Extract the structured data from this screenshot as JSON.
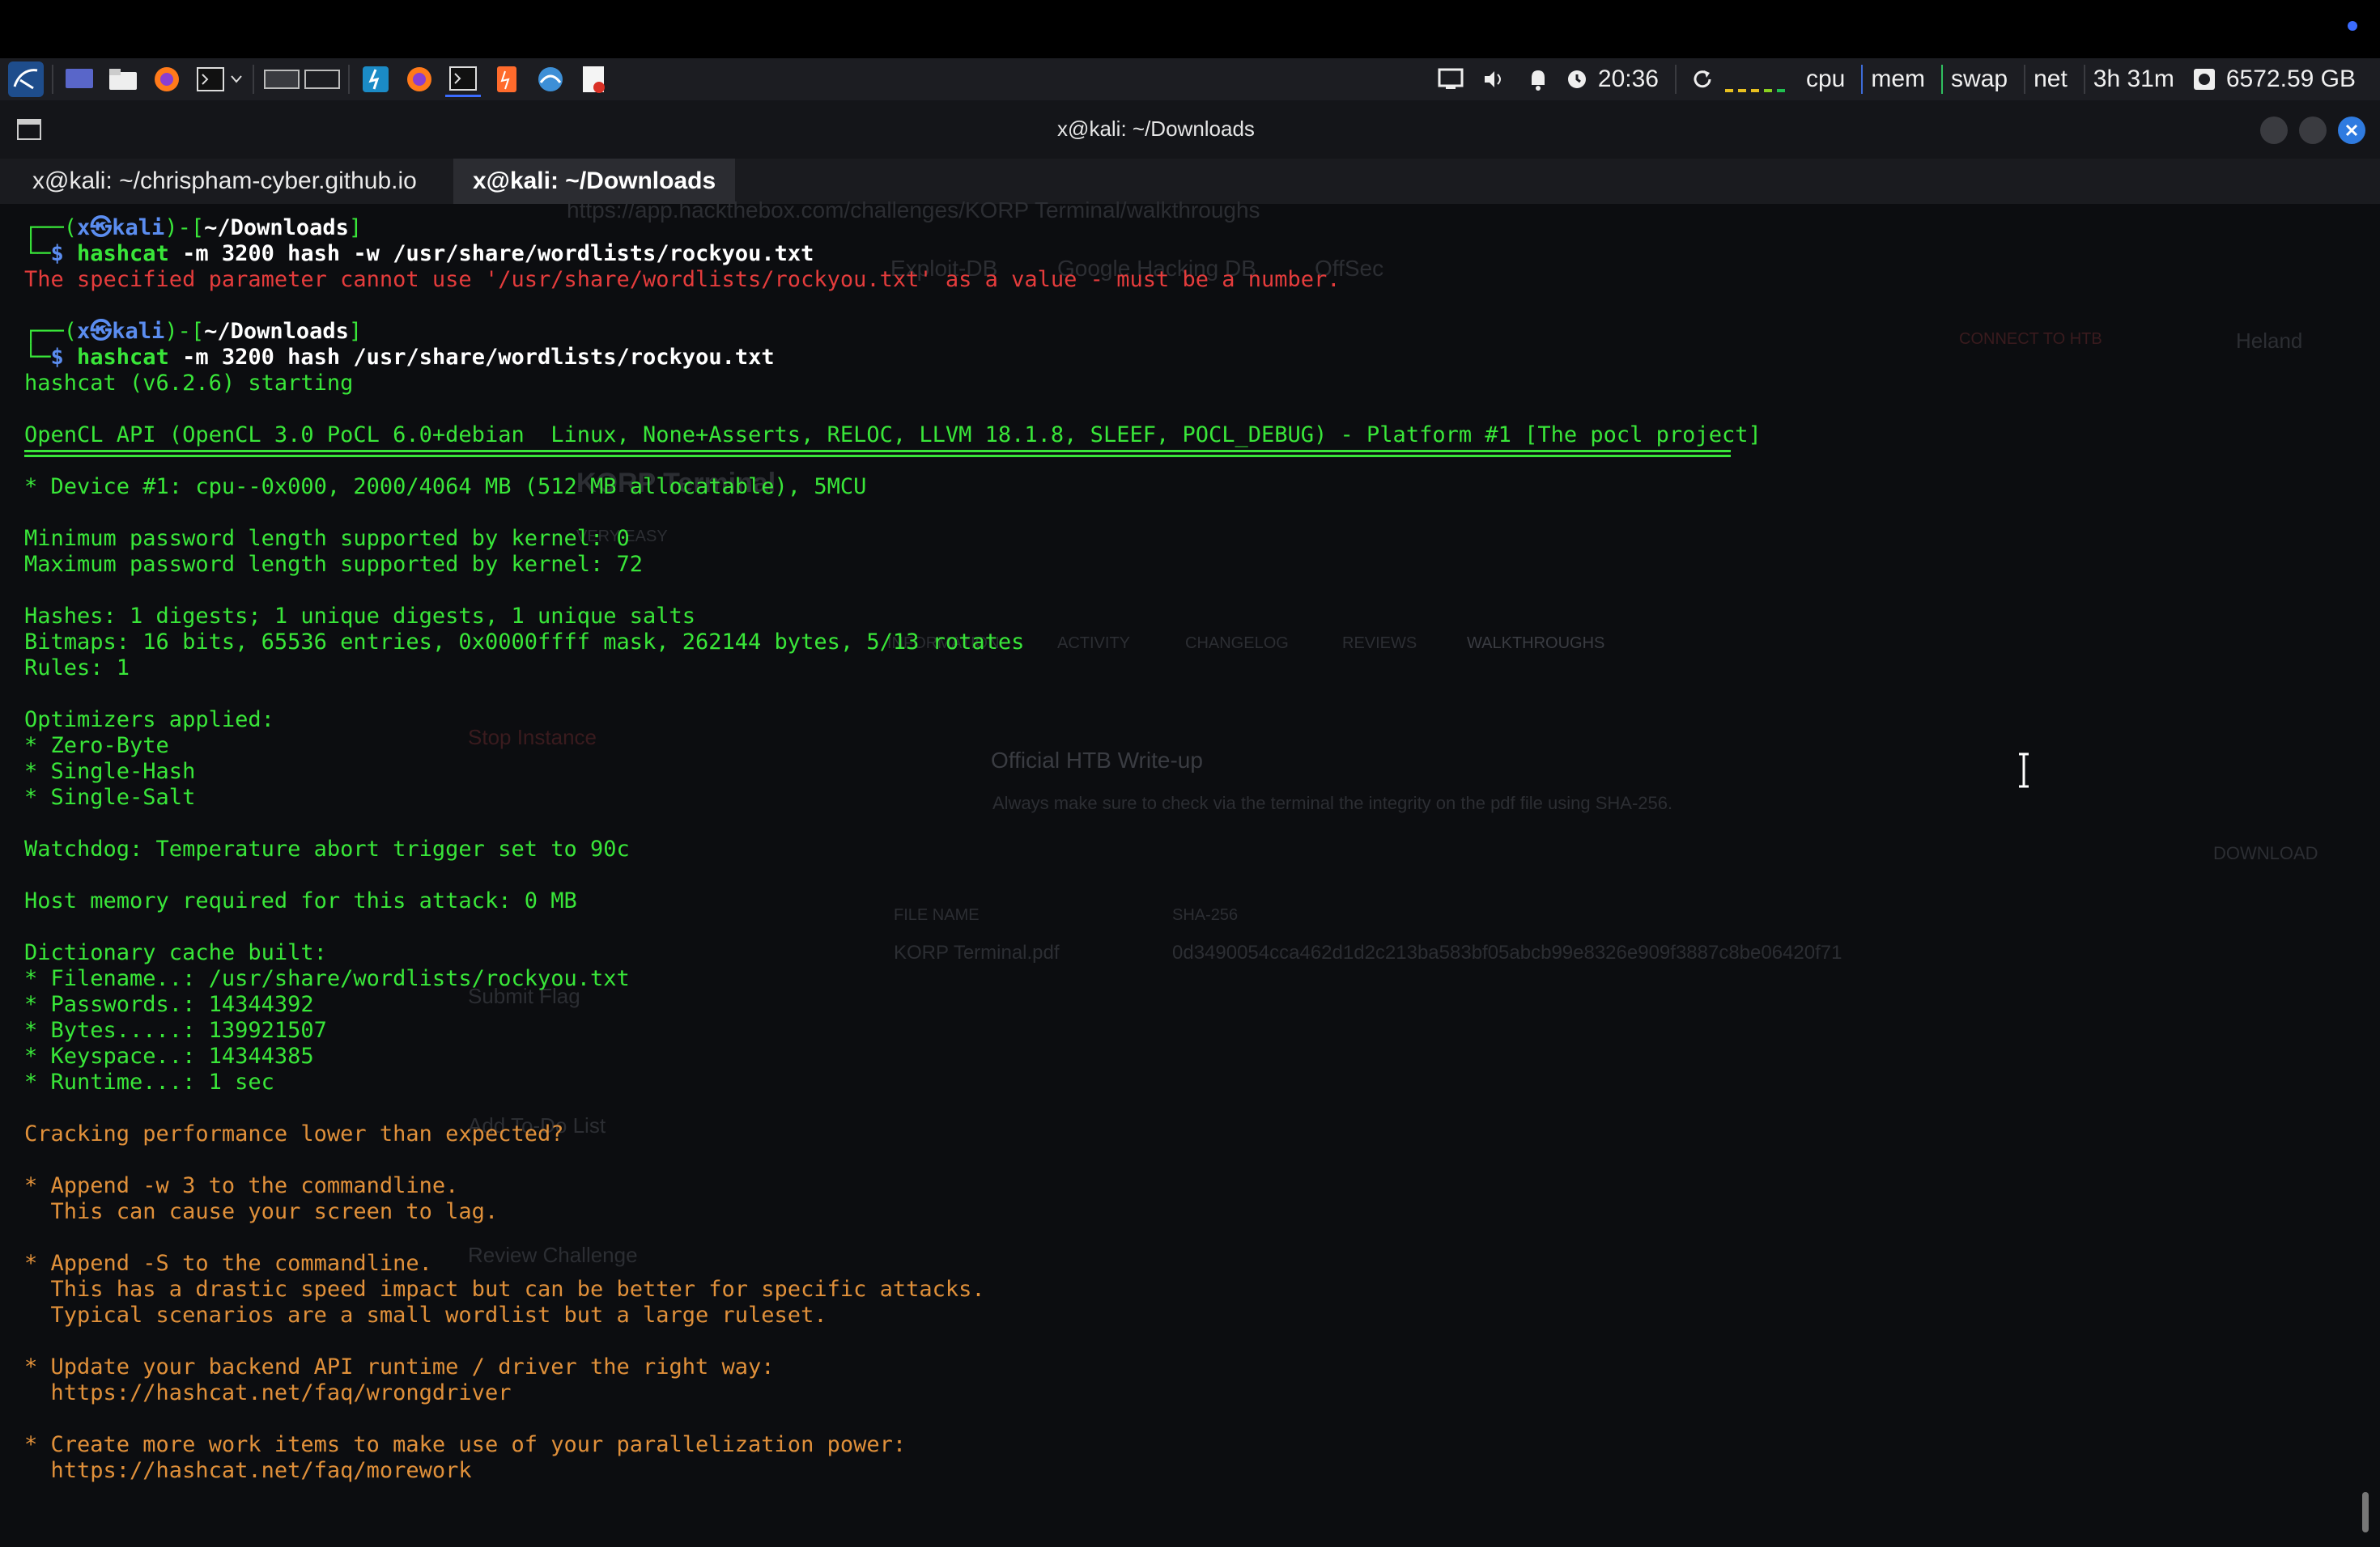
{
  "panel": {
    "clock": "20:36",
    "cpu_label": "cpu",
    "mem_label": "mem",
    "swap_label": "swap",
    "net_label": "net",
    "uptime": "3h 31m",
    "disk": "6572.59 GB"
  },
  "window": {
    "title": "x@kali: ~/Downloads",
    "tabs": [
      {
        "label": "x@kali: ~/chrispham-cyber.github.io",
        "active": false
      },
      {
        "label": "x@kali: ~/Downloads",
        "active": true
      }
    ]
  },
  "terminal": {
    "lines": [
      {
        "y": 0,
        "parts": [
          {
            "t": "┌──(",
            "c": "g"
          },
          {
            "t": "x㉿kali",
            "c": "b"
          },
          {
            "t": ")-[",
            "c": "g"
          },
          {
            "t": "~/Downloads",
            "c": "w"
          },
          {
            "t": "]",
            "c": "g"
          }
        ]
      },
      {
        "y": 1,
        "parts": [
          {
            "t": "└─",
            "c": "g"
          },
          {
            "t": "$ ",
            "c": "b"
          },
          {
            "t": "hashcat",
            "c": "gb"
          },
          {
            "t": " -m 3200 ",
            "c": "w"
          },
          {
            "t": "hash",
            "c": "w"
          },
          {
            "t": " -w ",
            "c": "w"
          },
          {
            "t": "/usr/share/wordlists/rockyou.txt",
            "c": "w"
          }
        ]
      },
      {
        "y": 2,
        "parts": [
          {
            "t": "The specified parameter cannot use '/usr/share/wordlists/rockyou.txt' as a value - must be a number.",
            "c": "r"
          }
        ]
      },
      {
        "y": 4,
        "parts": [
          {
            "t": "┌──(",
            "c": "g"
          },
          {
            "t": "x㉿kali",
            "c": "b"
          },
          {
            "t": ")-[",
            "c": "g"
          },
          {
            "t": "~/Downloads",
            "c": "w"
          },
          {
            "t": "]",
            "c": "g"
          }
        ]
      },
      {
        "y": 5,
        "parts": [
          {
            "t": "└─",
            "c": "g"
          },
          {
            "t": "$ ",
            "c": "b"
          },
          {
            "t": "hashcat",
            "c": "gb"
          },
          {
            "t": " -m 3200 ",
            "c": "w"
          },
          {
            "t": "hash",
            "c": "w"
          },
          {
            "t": " /usr/share/wordlists/rockyou.txt",
            "c": "w"
          }
        ]
      },
      {
        "y": 6,
        "parts": [
          {
            "t": "hashcat (v6.2.6) starting",
            "c": "g"
          }
        ]
      },
      {
        "y": 8,
        "parts": [
          {
            "t": "OpenCL API (OpenCL 3.0 PoCL 6.0+debian  Linux, None+Asserts, RELOC, LLVM 18.1.8, SLEEF, POCL_DEBUG) - Platform #1 [The pocl project]",
            "c": "g"
          }
        ]
      },
      {
        "y": 10,
        "parts": [
          {
            "t": "* Device #1: cpu--0x000, 2000/4064 MB (512 MB allocatable), 5MCU",
            "c": "g"
          }
        ]
      },
      {
        "y": 12,
        "parts": [
          {
            "t": "Minimum password length supported by kernel: 0",
            "c": "g"
          }
        ]
      },
      {
        "y": 13,
        "parts": [
          {
            "t": "Maximum password length supported by kernel: 72",
            "c": "g"
          }
        ]
      },
      {
        "y": 15,
        "parts": [
          {
            "t": "Hashes: 1 digests; 1 unique digests, 1 unique salts",
            "c": "g"
          }
        ]
      },
      {
        "y": 16,
        "parts": [
          {
            "t": "Bitmaps: 16 bits, 65536 entries, 0x0000ffff mask, 262144 bytes, 5/13 rotates",
            "c": "g"
          }
        ]
      },
      {
        "y": 17,
        "parts": [
          {
            "t": "Rules: 1",
            "c": "g"
          }
        ]
      },
      {
        "y": 19,
        "parts": [
          {
            "t": "Optimizers applied:",
            "c": "g"
          }
        ]
      },
      {
        "y": 20,
        "parts": [
          {
            "t": "* Zero-Byte",
            "c": "g"
          }
        ]
      },
      {
        "y": 21,
        "parts": [
          {
            "t": "* Single-Hash",
            "c": "g"
          }
        ]
      },
      {
        "y": 22,
        "parts": [
          {
            "t": "* Single-Salt",
            "c": "g"
          }
        ]
      },
      {
        "y": 24,
        "parts": [
          {
            "t": "Watchdog: Temperature abort trigger set to 90c",
            "c": "g"
          }
        ]
      },
      {
        "y": 26,
        "parts": [
          {
            "t": "Host memory required for this attack: 0 MB",
            "c": "g"
          }
        ]
      },
      {
        "y": 28,
        "parts": [
          {
            "t": "Dictionary cache built:",
            "c": "g"
          }
        ]
      },
      {
        "y": 29,
        "parts": [
          {
            "t": "* Filename..: /usr/share/wordlists/rockyou.txt",
            "c": "g"
          }
        ]
      },
      {
        "y": 30,
        "parts": [
          {
            "t": "* Passwords.: 14344392",
            "c": "g"
          }
        ]
      },
      {
        "y": 31,
        "parts": [
          {
            "t": "* Bytes.....: 139921507",
            "c": "g"
          }
        ]
      },
      {
        "y": 32,
        "parts": [
          {
            "t": "* Keyspace..: 14344385",
            "c": "g"
          }
        ]
      },
      {
        "y": 33,
        "parts": [
          {
            "t": "* Runtime...: 1 sec",
            "c": "g"
          }
        ]
      },
      {
        "y": 35,
        "parts": [
          {
            "t": "Cracking performance lower than expected?",
            "c": "o"
          }
        ]
      },
      {
        "y": 37,
        "parts": [
          {
            "t": "* Append -w 3 to the commandline.",
            "c": "o"
          }
        ]
      },
      {
        "y": 38,
        "parts": [
          {
            "t": "  This can cause your screen to lag.",
            "c": "o"
          }
        ]
      },
      {
        "y": 40,
        "parts": [
          {
            "t": "* Append -S to the commandline.",
            "c": "o"
          }
        ]
      },
      {
        "y": 41,
        "parts": [
          {
            "t": "  This has a drastic speed impact but can be better for specific attacks.",
            "c": "o"
          }
        ]
      },
      {
        "y": 42,
        "parts": [
          {
            "t": "  Typical scenarios are a small wordlist but a large ruleset.",
            "c": "o"
          }
        ]
      },
      {
        "y": 44,
        "parts": [
          {
            "t": "* Update your backend API runtime / driver the right way:",
            "c": "o"
          }
        ]
      },
      {
        "y": 45,
        "parts": [
          {
            "t": "  https://hashcat.net/faq/wrongdriver",
            "c": "o"
          }
        ]
      },
      {
        "y": 47,
        "parts": [
          {
            "t": "* Create more work items to make use of your parallelization power:",
            "c": "o"
          }
        ]
      },
      {
        "y": 48,
        "parts": [
          {
            "t": "  https://hashcat.net/faq/morework",
            "c": "o"
          }
        ]
      }
    ]
  },
  "background_browser": {
    "url": "https://app.hackthebox.com/challenges/KORP Terminal/walkthroughs",
    "challenge_title": "KORP Terminal",
    "difficulty": "VERY EASY",
    "tabs": [
      "INFORMATION",
      "ACTIVITY",
      "CHANGELOG",
      "REVIEWS",
      "WALKTHROUGHS"
    ],
    "writeup_title": "Official HTB Write-up",
    "writeup_desc": "Always make sure to check via the terminal the integrity on the pdf file using SHA-256.",
    "file_name_header": "FILE NAME",
    "sha_header": "SHA-256",
    "file_name": "KORP Terminal.pdf",
    "sha": "0d3490054cca462d1d2c213ba583bf05abcb99e8326e909f3887c8be06420f71",
    "download_label": "DOWNLOAD",
    "connect_label": "CONNECT TO HTB",
    "user": "Heland",
    "menu": [
      "Stop Instance",
      "Submit Flag",
      "Add To-Do List",
      "Review Challenge"
    ],
    "bookmarks": [
      "Exploit-DB",
      "Google Hacking DB",
      "OffSec"
    ]
  }
}
